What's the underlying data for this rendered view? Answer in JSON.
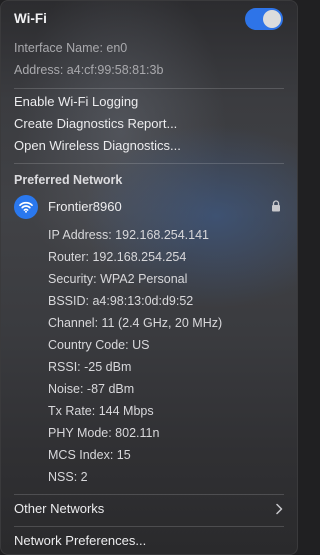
{
  "header": {
    "title": "Wi-Fi",
    "toggle_on": true,
    "interface_name": "Interface Name: en0",
    "address": "Address: a4:cf:99:58:81:3b"
  },
  "actions": {
    "enable_logging": "Enable Wi-Fi Logging",
    "diagnostics_report": "Create Diagnostics Report...",
    "wireless_diagnostics": "Open Wireless Diagnostics..."
  },
  "preferred": {
    "heading": "Preferred Network",
    "network_name": "Frontier8960",
    "details": [
      "IP Address: 192.168.254.141",
      "Router: 192.168.254.254",
      "Security: WPA2 Personal",
      "BSSID: a4:98:13:0d:d9:52",
      "Channel: 11 (2.4 GHz, 20 MHz)",
      "Country Code: US",
      "RSSI: -25 dBm",
      "Noise: -87 dBm",
      "Tx Rate: 144 Mbps",
      "PHY Mode: 802.11n",
      "MCS Index: 15",
      "NSS: 2"
    ]
  },
  "other_networks": "Other Networks",
  "network_preferences": "Network Preferences...",
  "colors": {
    "accent": "#2e74e8",
    "wifi_badge": "#2a78ee"
  },
  "icons": [
    "wifi-icon",
    "lock-icon",
    "chevron-right-icon"
  ]
}
